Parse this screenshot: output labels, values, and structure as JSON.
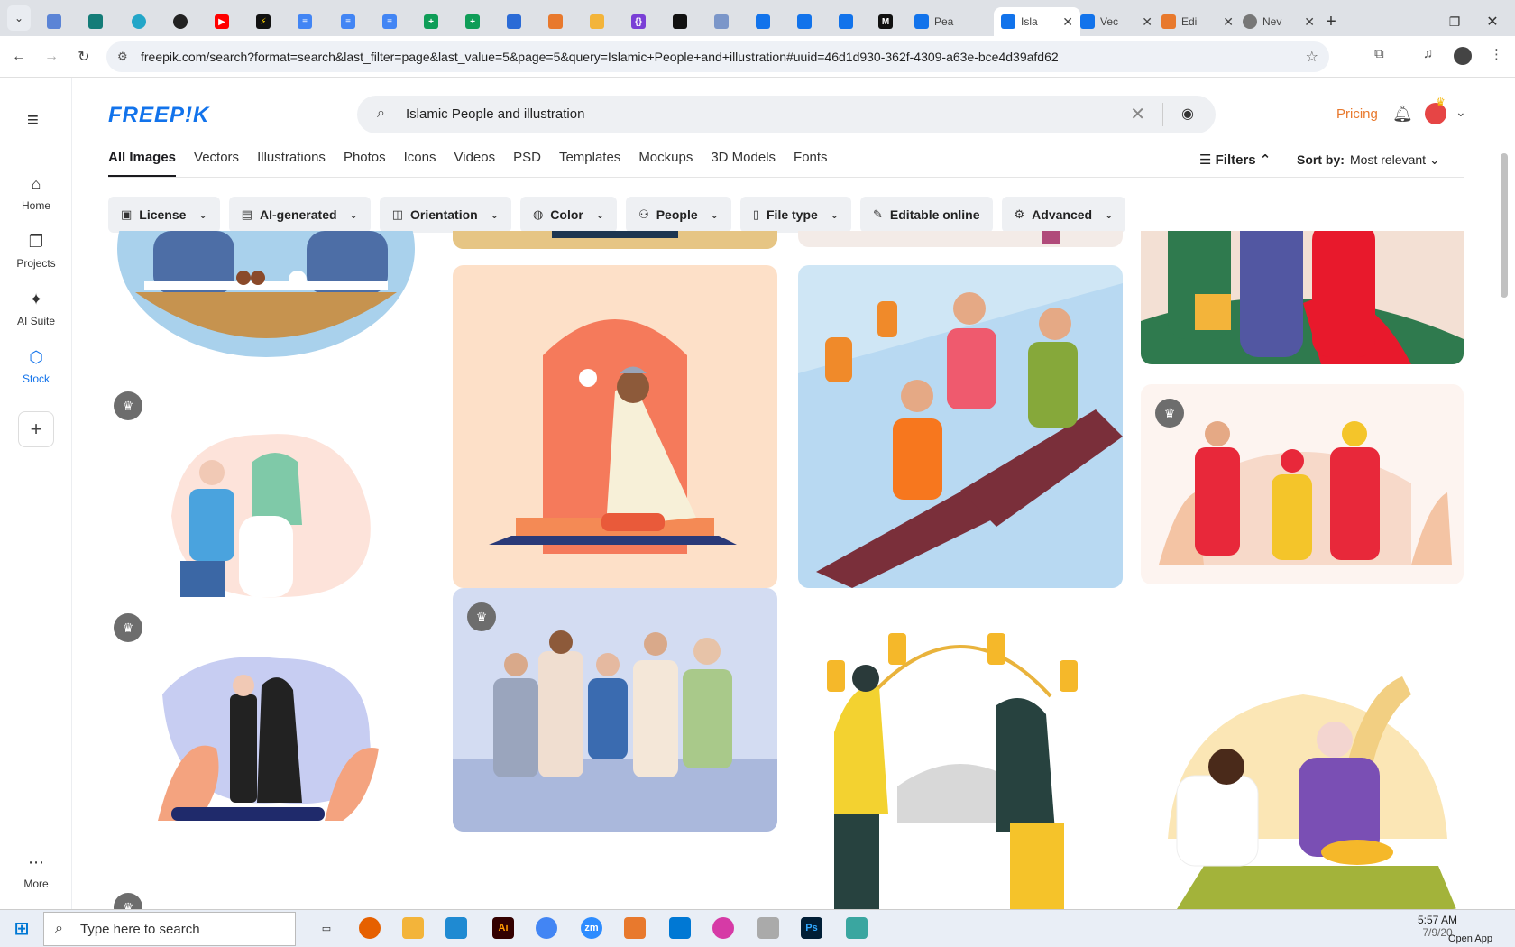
{
  "browser": {
    "tabs": [
      {
        "title": "Pea",
        "icon": "freepik-icon"
      },
      {
        "title": "Isla",
        "icon": "freepik-icon"
      },
      {
        "title": "Vec",
        "icon": "freepik-icon"
      },
      {
        "title": "Edi",
        "icon": "code-icon"
      },
      {
        "title": "Nev",
        "icon": "globe-icon"
      }
    ],
    "url": "freepik.com/search?format=search&last_filter=page&last_value=5&page=5&query=Islamic+People+and+illustration#uuid=46d1d930-362f-4309-a63e-bce4d39afd62"
  },
  "sidebar": {
    "items": [
      {
        "label": "Home",
        "icon": "home-icon"
      },
      {
        "label": "Projects",
        "icon": "projects-icon"
      },
      {
        "label": "AI Suite",
        "icon": "sparkle-icon"
      },
      {
        "label": "Stock",
        "icon": "stock-icon"
      },
      {
        "label": "More",
        "icon": "more-icon"
      }
    ]
  },
  "header": {
    "logo": "FREEP!K",
    "search_value": "Islamic People and illustration",
    "pricing": "Pricing"
  },
  "content_tabs": [
    "All Images",
    "Vectors",
    "Illustrations",
    "Photos",
    "Icons",
    "Videos",
    "PSD",
    "Templates",
    "Mockups",
    "3D Models",
    "Fonts"
  ],
  "toolbar": {
    "filters_label": "Filters",
    "sort_label": "Sort by:",
    "sort_value": "Most relevant"
  },
  "filter_chips": [
    {
      "label": "License",
      "icon": "license-icon"
    },
    {
      "label": "AI-generated",
      "icon": "ai-icon"
    },
    {
      "label": "Orientation",
      "icon": "orientation-icon"
    },
    {
      "label": "Color",
      "icon": "palette-icon"
    },
    {
      "label": "People",
      "icon": "people-icon"
    },
    {
      "label": "File type",
      "icon": "file-icon"
    },
    {
      "label": "Editable online",
      "icon": "pencil-icon"
    },
    {
      "label": "Advanced",
      "icon": "gear-icon"
    }
  ],
  "taskbar": {
    "search_placeholder": "Type here to search",
    "time": "5:57 AM",
    "date": "7/9/20",
    "open_app": "Open App"
  },
  "colors": {
    "brand": "#1273eb",
    "pricing": "#e8792d"
  }
}
